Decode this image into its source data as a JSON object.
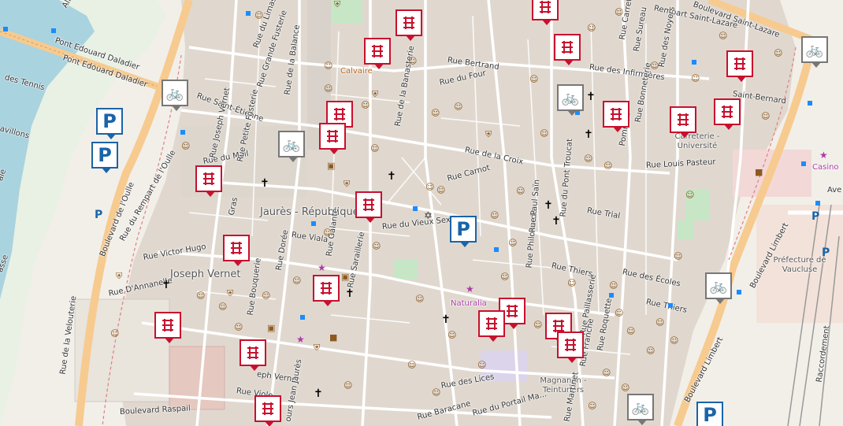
{
  "map": {
    "colors": {
      "land": "#f2efe9",
      "water": "#a9d3df",
      "residential": "#e0d8cf",
      "major_road": "#f7ca8f",
      "marker_red": "#c8102e",
      "marker_gray": "#777777",
      "parking_blue": "#1a64a8"
    },
    "labels": [
      {
        "id": "allee-tennis",
        "text": "Allée ..."
      },
      {
        "id": "pont-daladier-1",
        "text": "Pont Edouard Daladier"
      },
      {
        "id": "pont-daladier-2",
        "text": "Pont Edouard Daladier"
      },
      {
        "id": "tennis",
        "text": "des Tennis"
      },
      {
        "id": "villons",
        "text": "avillons"
      },
      {
        "id": "boulevard-oulle",
        "text": "Boulevard de l'Oulle"
      },
      {
        "id": "rempart-oulle",
        "text": "Rue du Rempart de l'Oulle"
      },
      {
        "id": "rue-limas",
        "text": "Rue du Limas"
      },
      {
        "id": "grande-fusterie",
        "text": "Rue Grande Fusterie"
      },
      {
        "id": "saint-etienne",
        "text": "Rue Saint-Étienne"
      },
      {
        "id": "rue-balance",
        "text": "Rue de la Balance"
      },
      {
        "id": "calvaire",
        "text": "Calvaire"
      },
      {
        "id": "rue-bertrand",
        "text": "Rue Bertrand"
      },
      {
        "id": "rue-four",
        "text": "Rue du Four"
      },
      {
        "id": "rue-banasterie",
        "text": "Rue de la Banasterie"
      },
      {
        "id": "rue-croix",
        "text": "Rue de la Croix"
      },
      {
        "id": "rue-carnot",
        "text": "Rue Carnot"
      },
      {
        "id": "rue-mail",
        "text": "Rue du Mail"
      },
      {
        "id": "joseph-vernet-rue",
        "text": "Rue Joseph Vernet"
      },
      {
        "id": "petite-fusterie",
        "text": "Rue Petite Fusterie"
      },
      {
        "id": "gras",
        "text": "Gras"
      },
      {
        "id": "jaures",
        "text": "Jaurès - République"
      },
      {
        "id": "rue-viala",
        "text": "Rue Viala"
      },
      {
        "id": "rue-doree",
        "text": "Rue Dorée"
      },
      {
        "id": "rue-galante",
        "text": "Rue Galante"
      },
      {
        "id": "rue-saraillerie",
        "text": "Rue Saraillerie"
      },
      {
        "id": "vieux-sextier",
        "text": "Rue du Vieux Sextier"
      },
      {
        "id": "victor-hugo",
        "text": "Rue Victor Hugo"
      },
      {
        "id": "joseph-vernet",
        "text": "Joseph Vernet"
      },
      {
        "id": "annanelle",
        "text": "Rue D'Annanelle"
      },
      {
        "id": "rue-bouquerie",
        "text": "Rue Bouquerie"
      },
      {
        "id": "rue-velouterie",
        "text": "Rue de la Velouterie"
      },
      {
        "id": "rue-jvernet-2",
        "text": "eph Vernet"
      },
      {
        "id": "rue-violette",
        "text": "Rue Viole"
      },
      {
        "id": "bd-raspail",
        "text": "Boulevard Raspail"
      },
      {
        "id": "jean-jaures",
        "text": "ours Jean Jaurès"
      },
      {
        "id": "naturalia",
        "text": "Naturalia"
      },
      {
        "id": "rue-thiers",
        "text": "Rue Thiers"
      },
      {
        "id": "rue-thiers-2",
        "text": "Rue Thiers"
      },
      {
        "id": "philonarde",
        "text": "Rue Philonarde"
      },
      {
        "id": "paul-saïn",
        "text": "Rue Paul Saïn"
      },
      {
        "id": "pont-troucat",
        "text": "Rue du Pont Troucat"
      },
      {
        "id": "rue-trial",
        "text": "Rue Trial"
      },
      {
        "id": "rue-ecoles",
        "text": "Rue des Écoles"
      },
      {
        "id": "rue-lices",
        "text": "Rue des Lices"
      },
      {
        "id": "baracane",
        "text": "Rue Baracane"
      },
      {
        "id": "portail-magnanen",
        "text": "Rue du Portail Ma..."
      },
      {
        "id": "magnanen",
        "text": "Magnanen - Teinturiers"
      },
      {
        "id": "rue-martinet",
        "text": "Rue Martinet"
      },
      {
        "id": "rue-roquette",
        "text": "Rue Roquette"
      },
      {
        "id": "pailla",
        "text": "Rue Paillasserie"
      },
      {
        "id": "franche",
        "text": "Rue Franche"
      },
      {
        "id": "infirmieres",
        "text": "Rue des Infirmières"
      },
      {
        "id": "rempart-lazare",
        "text": "Rempart Saint-Lazare"
      },
      {
        "id": "bd-lazare",
        "text": "Boulevard Saint-Lazare"
      },
      {
        "id": "rue-carreterie",
        "text": "Rue Carreterie"
      },
      {
        "id": "rue-sureau",
        "text": "Rue Sureau"
      },
      {
        "id": "rue-noyers",
        "text": "Rue des Noyers"
      },
      {
        "id": "saint-bernard",
        "text": "Saint-Bernard"
      },
      {
        "id": "bonneterie",
        "text": "Rue Bonneterie"
      },
      {
        "id": "pommier",
        "text": "Pommier"
      },
      {
        "id": "carreterie-univ",
        "text": "Carreterie - Université"
      },
      {
        "id": "louis-pasteur",
        "text": "Rue Louis Pasteur"
      },
      {
        "id": "casino",
        "text": "Casino"
      },
      {
        "id": "ave",
        "text": "Ave"
      },
      {
        "id": "prefecture",
        "text": "Préfecture de Vaucluse"
      },
      {
        "id": "bd-limbert-1",
        "text": "Boulevard Limbert"
      },
      {
        "id": "bd-limbert-2",
        "text": "Boulevard Limbert"
      },
      {
        "id": "raccordement",
        "text": "Raccordement"
      },
      {
        "id": "passe",
        "text": "asse"
      },
      {
        "id": "ale",
        "text": "ale"
      }
    ],
    "markers": [
      {
        "id": "gtfs-1",
        "type": "bus-route",
        "color": "red"
      },
      {
        "id": "gtfs-2",
        "type": "bus-route",
        "color": "red"
      },
      {
        "id": "gtfs-3",
        "type": "bus-route",
        "color": "red"
      },
      {
        "id": "gtfs-4",
        "type": "bus-route",
        "color": "red"
      },
      {
        "id": "gtfs-5",
        "type": "bus-route",
        "color": "red"
      },
      {
        "id": "gtfs-6",
        "type": "bus-route",
        "color": "red"
      },
      {
        "id": "gtfs-7",
        "type": "bus-route",
        "color": "red"
      },
      {
        "id": "gtfs-8",
        "type": "bus-route",
        "color": "red"
      },
      {
        "id": "gtfs-9",
        "type": "bus-route",
        "color": "red"
      },
      {
        "id": "gtfs-10",
        "type": "bus-route",
        "color": "red"
      },
      {
        "id": "gtfs-11",
        "type": "bus-route",
        "color": "red"
      },
      {
        "id": "gtfs-12",
        "type": "bus-route",
        "color": "red"
      },
      {
        "id": "gtfs-13",
        "type": "bus-route",
        "color": "red"
      },
      {
        "id": "gtfs-14",
        "type": "bus-route",
        "color": "red"
      },
      {
        "id": "gtfs-15",
        "type": "bus-route",
        "color": "red"
      },
      {
        "id": "gtfs-16",
        "type": "bus-route",
        "color": "red"
      },
      {
        "id": "gtfs-17",
        "type": "bus-route",
        "color": "red"
      },
      {
        "id": "gtfs-18",
        "type": "bus-route",
        "color": "red"
      },
      {
        "id": "gtfs-19",
        "type": "bus-route",
        "color": "red"
      },
      {
        "id": "gtfs-20",
        "type": "bus-route",
        "color": "red"
      },
      {
        "id": "bike-1",
        "type": "bike-station",
        "color": "gray"
      },
      {
        "id": "bike-2",
        "type": "bike-station",
        "color": "gray"
      },
      {
        "id": "bike-3",
        "type": "bike-station",
        "color": "gray"
      },
      {
        "id": "bike-4",
        "type": "bike-station",
        "color": "gray"
      },
      {
        "id": "bike-5",
        "type": "bike-station",
        "color": "gray"
      },
      {
        "id": "bike-6",
        "type": "bike-station",
        "color": "gray"
      },
      {
        "id": "bike-7",
        "type": "bike-station",
        "color": "gray"
      }
    ],
    "parking": [
      {
        "id": "park-1",
        "text": "P"
      },
      {
        "id": "park-2",
        "text": "P"
      },
      {
        "id": "park-3",
        "text": "P"
      },
      {
        "id": "park-4",
        "text": "P"
      }
    ]
  }
}
